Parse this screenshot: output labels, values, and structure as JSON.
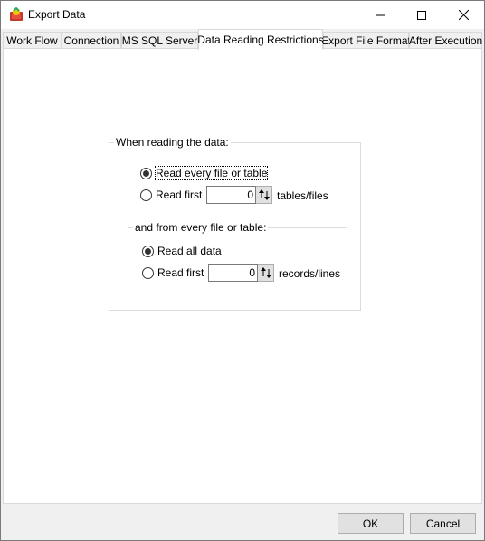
{
  "window": {
    "title": "Export Data"
  },
  "tabs": [
    {
      "label": "Work Flow"
    },
    {
      "label": "Connection"
    },
    {
      "label": "MS SQL Server"
    },
    {
      "label": "Data Reading Restrictions",
      "active": true
    },
    {
      "label": "Export File Format"
    },
    {
      "label": "After Execution"
    }
  ],
  "reading": {
    "group_label": "When reading the data:",
    "option_every": "Read every file or table",
    "option_first": "Read first",
    "first_value": "0",
    "first_unit": "tables/files",
    "selected": "every"
  },
  "from_every": {
    "group_label": "and from every file or table:",
    "option_all": "Read all data",
    "option_first": "Read first",
    "first_value": "0",
    "first_unit": "records/lines",
    "selected": "all"
  },
  "buttons": {
    "ok": "OK",
    "cancel": "Cancel"
  },
  "colors": {
    "titlebar": "#ffffff",
    "panel": "#ffffff",
    "chrome": "#f0f0f0"
  }
}
